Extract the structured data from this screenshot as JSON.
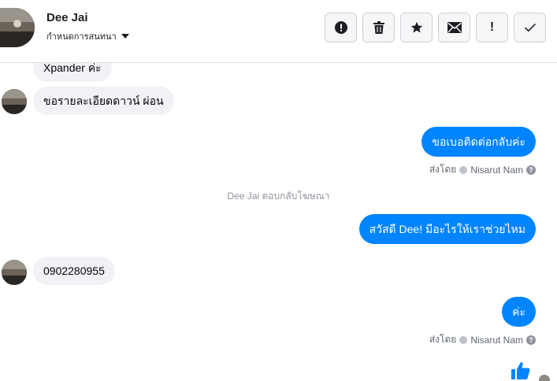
{
  "header": {
    "name": "Dee Jai",
    "assign_label": "กำหนดการสนทนา"
  },
  "toolbar": {
    "buttons": [
      {
        "icon": "alert-circle-icon"
      },
      {
        "icon": "trash-icon"
      },
      {
        "icon": "star-icon"
      },
      {
        "icon": "envelope-icon"
      },
      {
        "label": "!",
        "icon": "exclamation-icon"
      },
      {
        "icon": "check-icon"
      }
    ]
  },
  "messages": {
    "in1": "Xpander ค่ะ",
    "in2": "ขอรายละเอียดดาวน์ ผ่อน",
    "out1": "ขอเบอติดต่อกลับค่ะ",
    "sent_prefix": "ส่งโดย",
    "sender": "Nisarut Nam",
    "system": "Dee Jai ตอบกลับโฆษณา",
    "out2": "สวัสดี Dee! มีอะไรให้เราช่วยไหม",
    "in3": "0902280955",
    "out3": "ค่ะ"
  },
  "colors": {
    "accent": "#0084ff",
    "bubble_in": "#f0f2f5"
  }
}
